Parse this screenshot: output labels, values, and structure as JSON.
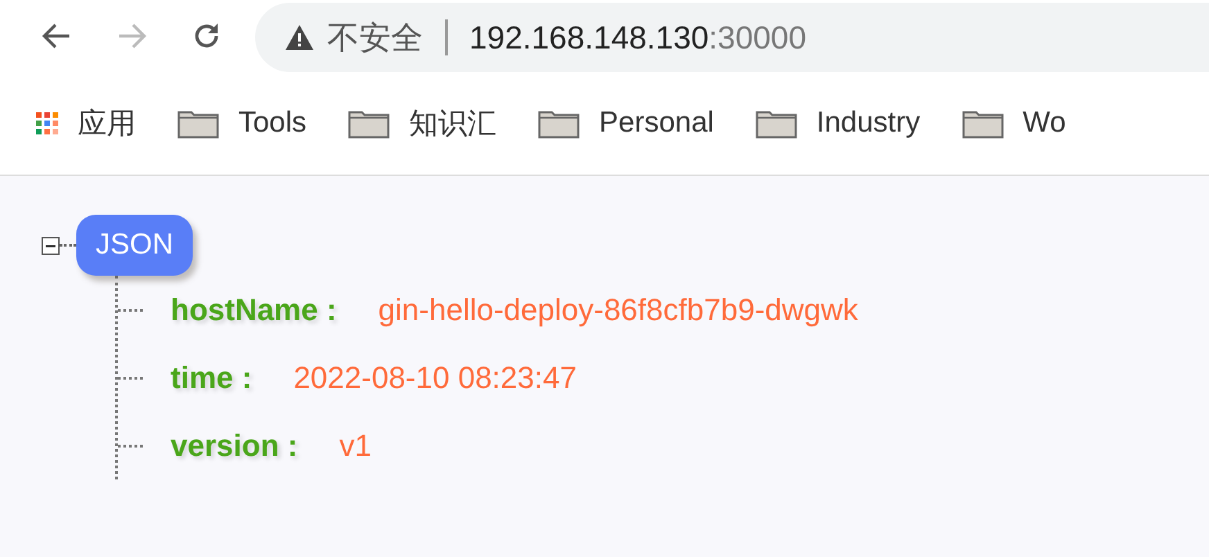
{
  "toolbar": {
    "back_disabled": false,
    "forward_disabled": true,
    "security": "不安全",
    "url_host": "192.168.148.130",
    "url_port": ":30000"
  },
  "bookmarks": [
    {
      "kind": "apps",
      "label": "应用"
    },
    {
      "kind": "folder",
      "label": "Tools"
    },
    {
      "kind": "folder",
      "label": "知识汇"
    },
    {
      "kind": "folder",
      "label": "Personal"
    },
    {
      "kind": "folder",
      "label": "Industry"
    },
    {
      "kind": "folder",
      "label": "Wo"
    }
  ],
  "tree": {
    "label": "JSON",
    "expanded": true,
    "children": [
      {
        "key": "hostName :",
        "value": "gin-hello-deploy-86f8cfb7b9-dwgwk"
      },
      {
        "key": "time :",
        "value": "2022-08-10 08:23:47"
      },
      {
        "key": "version :",
        "value": "v1"
      }
    ]
  }
}
